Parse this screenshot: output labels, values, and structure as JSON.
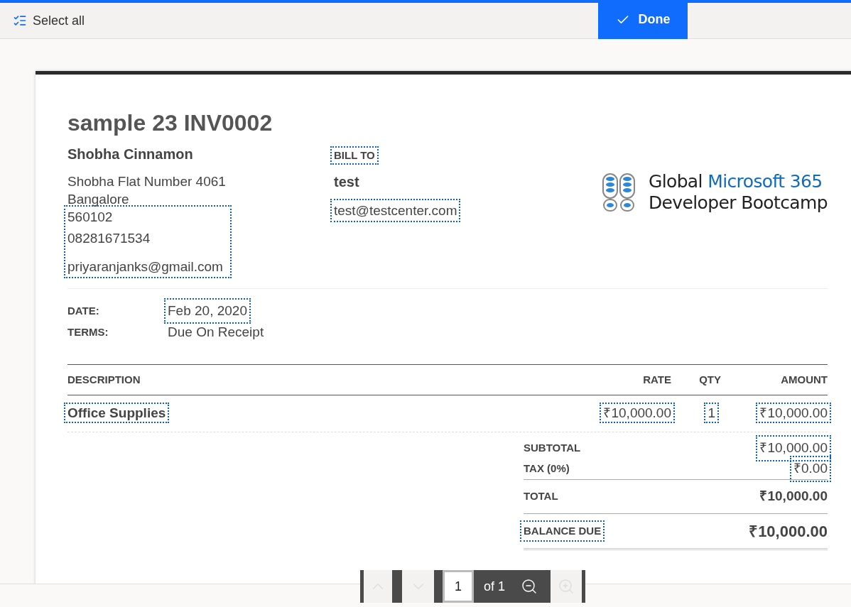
{
  "toolbar": {
    "select_all": "Select all",
    "done": "Done"
  },
  "invoice": {
    "title": "sample 23 INV0002",
    "from_name": "Shobha Cinnamon",
    "from_lines": [
      "Shobha Flat Number 4061",
      "Bangalore",
      "560102",
      "08281671534"
    ],
    "from_email": "priyaranjanks@gmail.com",
    "bill_to_label": "BILL TO",
    "bill_to_name": "test",
    "bill_to_email": "test@testcenter.com",
    "logo": {
      "line1_plain": "Global",
      "line1_accent": "Microsoft 365",
      "line2": "Developer Bootcamp"
    },
    "meta": [
      {
        "label": "DATE:",
        "value": "Feb 20, 2020"
      },
      {
        "label": "TERMS:",
        "value": "Due On Receipt"
      }
    ],
    "columns": [
      "DESCRIPTION",
      "RATE",
      "QTY",
      "AMOUNT"
    ],
    "rows": [
      {
        "description": "Office Supplies",
        "rate": "₹10,000.00",
        "qty": "1",
        "amount": "₹10,000.00"
      }
    ],
    "totals": [
      {
        "label": "SUBTOTAL",
        "value": "₹10,000.00",
        "kind": "plain"
      },
      {
        "label": "TAX (0%)",
        "value": "₹0.00",
        "kind": "plain"
      },
      {
        "label": "TOTAL",
        "value": "₹10,000.00",
        "kind": "total"
      },
      {
        "label": "BALANCE DUE",
        "value": "₹10,000.00",
        "kind": "balance"
      }
    ]
  },
  "pager": {
    "page": "1",
    "of": "of 1"
  }
}
